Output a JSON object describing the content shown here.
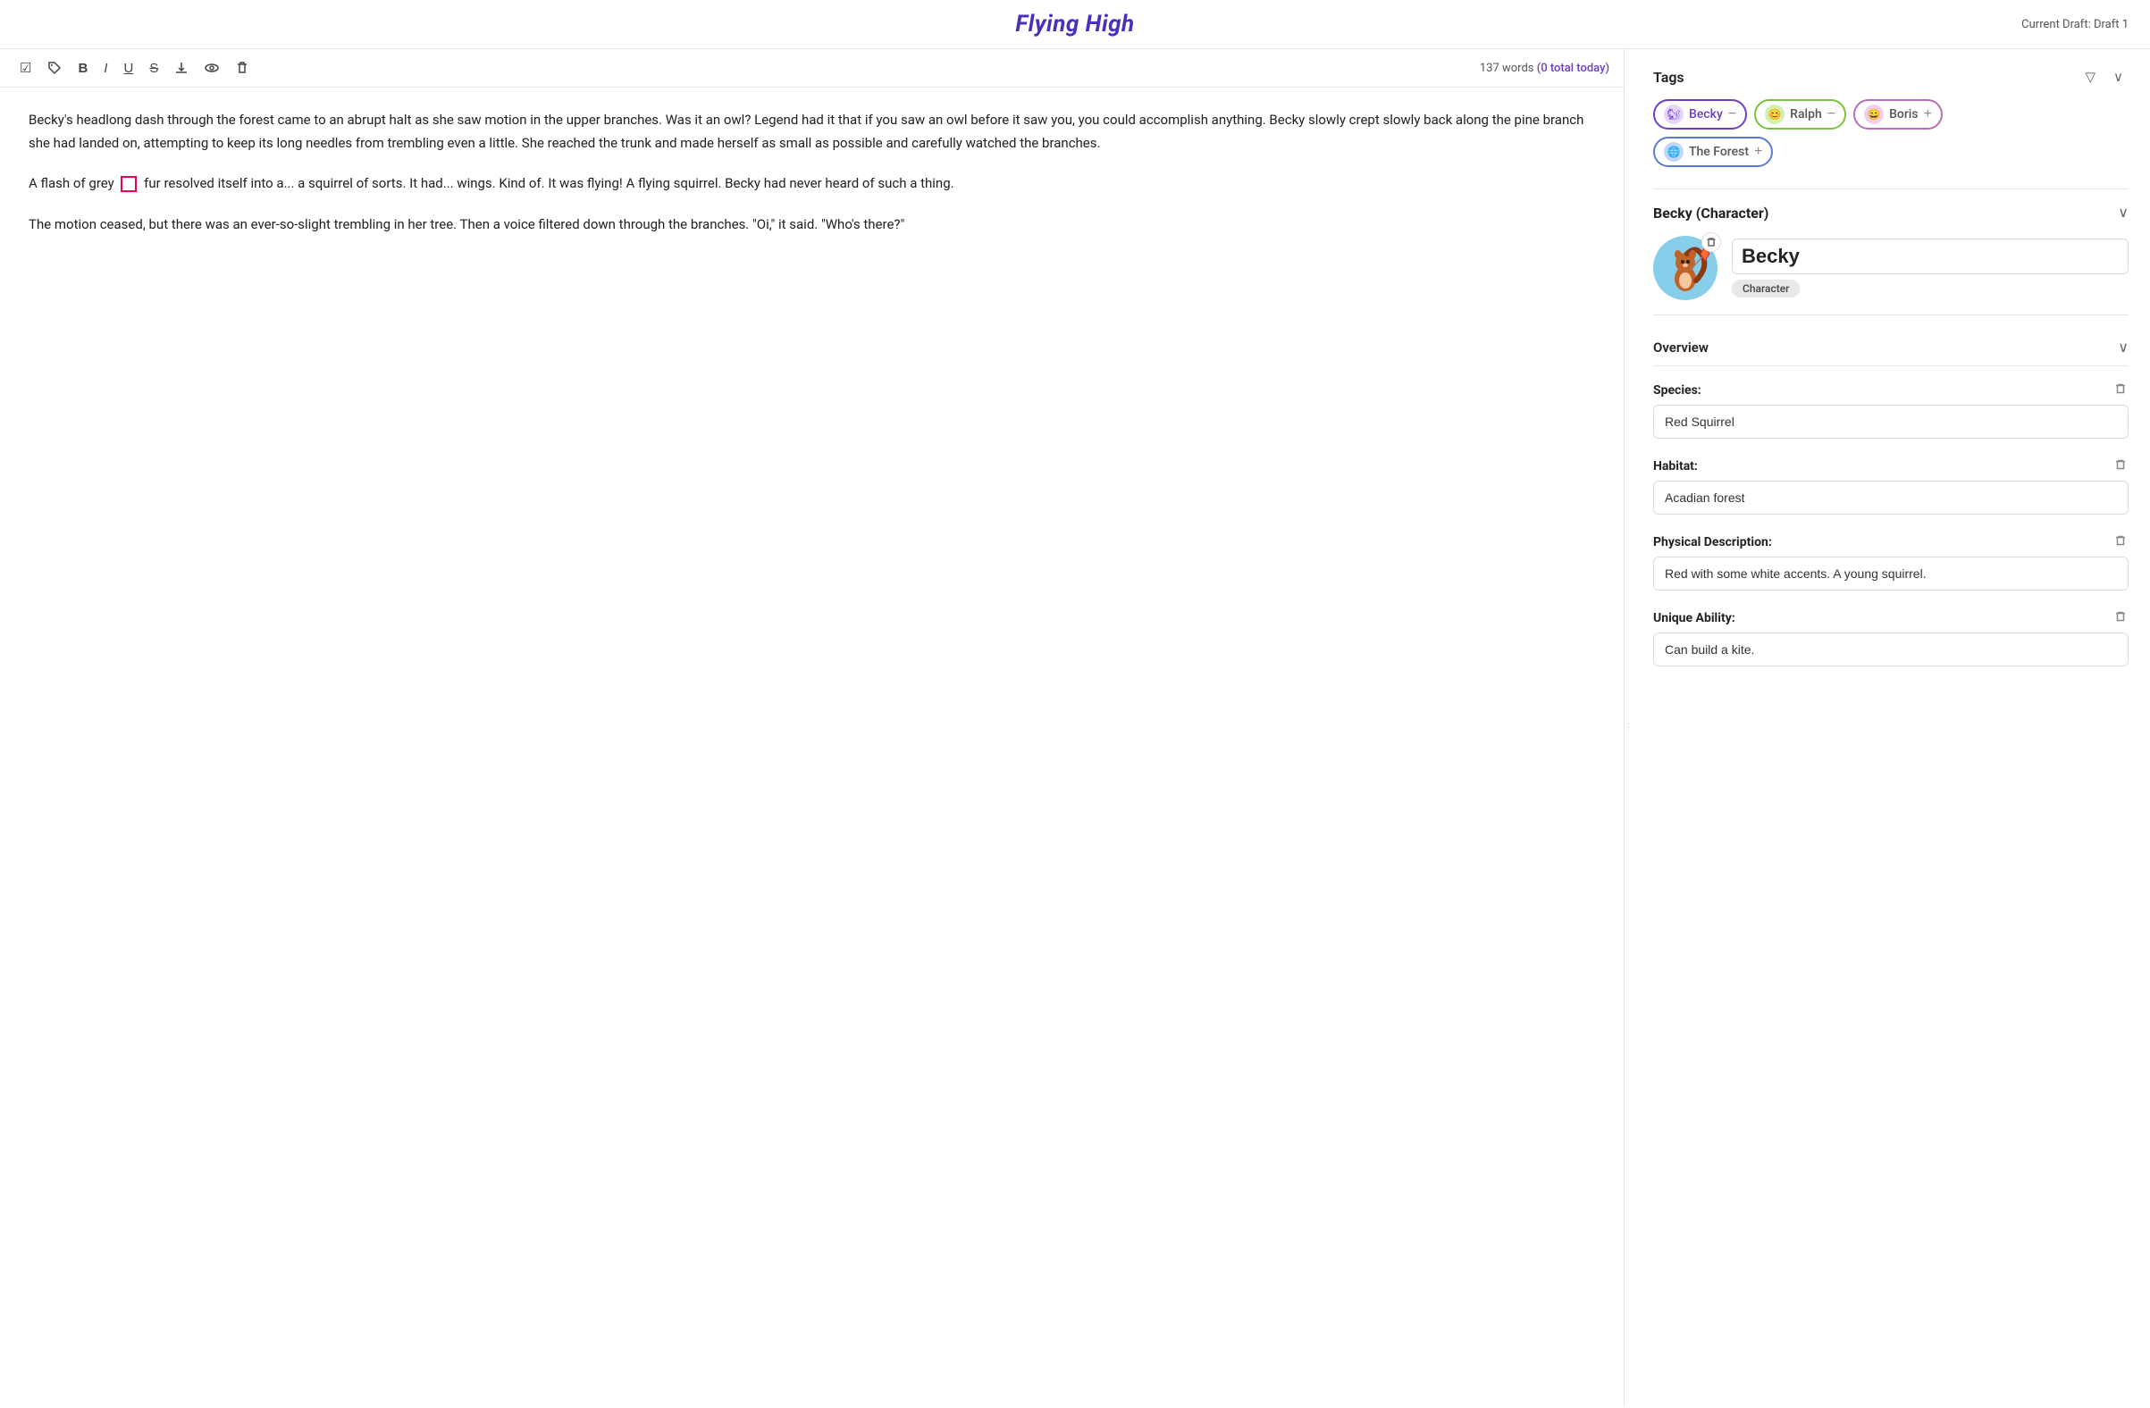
{
  "header": {
    "title": "Flying High",
    "draft_label": "Current Draft: Draft 1"
  },
  "toolbar": {
    "word_count": "137 words",
    "word_count_highlight": "(0 total today)"
  },
  "editor": {
    "paragraphs": [
      "Becky's headlong dash through the forest came to an abrupt halt as she saw motion in the upper branches. Was it an owl? Legend had it that if you saw an owl before it saw you, you could accomplish anything. Becky slowly crept slowly back along the pine branch she had landed on, attempting to keep its long needles from trembling even a little. She reached the trunk and made herself as small as possible and carefully watched the branches.",
      "A flash of grey [HIGHLIGHT] fur resolved itself into a... a squirrel of sorts. It had... wings. Kind of. It was flying! A flying squirrel. Becky had never heard of such a thing.",
      "The motion ceased, but there was an ever-so-slight trembling in her tree. Then a voice filtered down through the branches. \"Oi,\" it said. \"Who's there?\""
    ]
  },
  "tags": {
    "title": "Tags",
    "filter_icon": "▽",
    "chevron_icon": "∨",
    "items": [
      {
        "id": "becky",
        "label": "Becky",
        "color": "becky"
      },
      {
        "id": "ralph",
        "label": "Ralph",
        "color": "ralph"
      },
      {
        "id": "boris",
        "label": "Boris",
        "color": "boris"
      },
      {
        "id": "forest",
        "label": "The Forest",
        "color": "forest"
      }
    ]
  },
  "character_section": {
    "title": "Becky (Character)",
    "character": {
      "name": "Becky",
      "type": "Character",
      "species_label": "Species:",
      "species_value": "Red Squirrel",
      "habitat_label": "Habitat:",
      "habitat_value": "Acadian forest",
      "physical_desc_label": "Physical Description:",
      "physical_desc_value": "Red with some white accents. A young squirrel.",
      "unique_ability_label": "Unique Ability:",
      "unique_ability_value": "Can build a kite."
    },
    "overview_label": "Overview"
  }
}
